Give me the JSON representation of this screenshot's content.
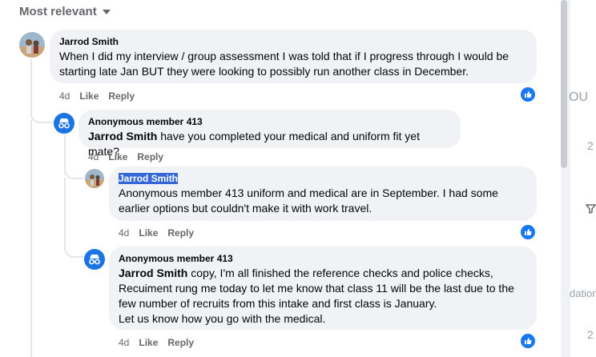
{
  "sort": {
    "label": "Most relevant"
  },
  "comments": [
    {
      "author": "Jarrod Smith",
      "text": "When I did my interview / group assessment I was told that if I progress through I would be starting late Jan BUT they were looking to possibly run another class in December.",
      "time": "4d",
      "like": "Like",
      "reply": "Reply"
    },
    {
      "author": "Anonymous member 413",
      "mention": "Jarrod Smith",
      "text": " have you completed your medical and uniform fit yet mate?",
      "time": "4d",
      "like": "Like",
      "reply": "Reply"
    },
    {
      "author": "Jarrod Smith",
      "text": "Anonymous member 413 uniform and medical are in September. I had some earlier options but couldn't make it with work travel.",
      "time": "4d",
      "like": "Like",
      "reply": "Reply"
    },
    {
      "author": "Anonymous member 413",
      "mention": "Jarrod Smith",
      "line1": " copy, I'm all finished the reference checks and police checks,",
      "line2": "Recuiment rung me today to let me know that class 11 will be the last due to the",
      "line3": "few number of recruits from this intake and first class is January.",
      "line4": "Let us know how you go with the medical.",
      "time": "4d",
      "like": "Like",
      "reply": "Reply"
    }
  ],
  "right": {
    "frag1": "OU",
    "frag2": "2",
    "frag3": "dation",
    "frag4": "2"
  },
  "colors": {
    "accent": "#1877f2",
    "anon_avatar": "#1b74e4",
    "bubble": "#f0f2f5"
  }
}
